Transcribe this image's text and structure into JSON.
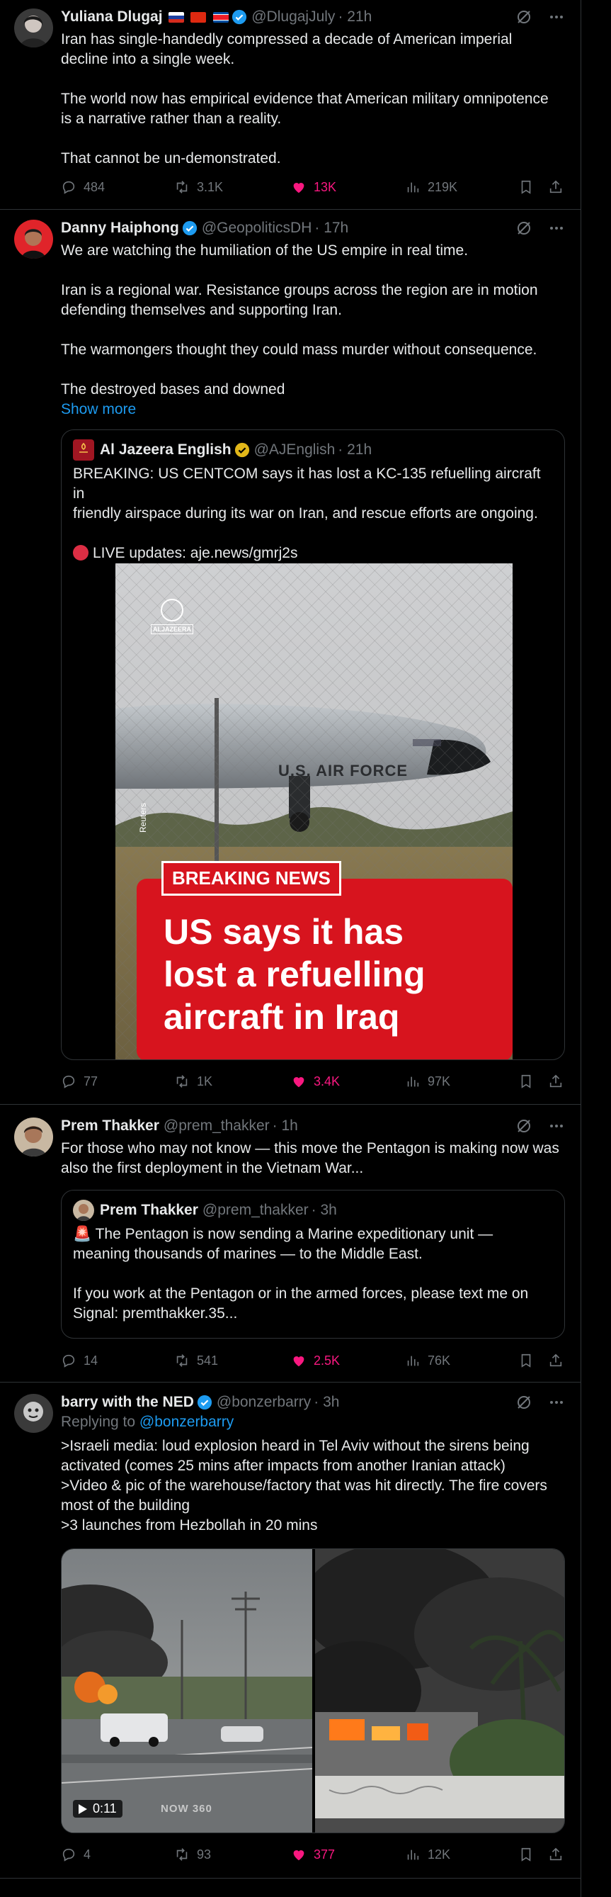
{
  "tweets": [
    {
      "name": "Yuliana Dlugaj",
      "handle": "@DlugajJuly",
      "time": "· 21h",
      "lines": [
        "Iran has single-handedly compressed a decade of American imperial",
        "decline into a single week.",
        "",
        "The world now has empirical evidence that American military omnipotence",
        "is a narrative rather than a reality.",
        "",
        "That cannot be un-demonstrated."
      ],
      "replies": "484",
      "reposts": "3.1K",
      "likes": "13K",
      "views": "219K"
    },
    {
      "name": "Danny Haiphong",
      "handle": "@GeopoliticsDH",
      "time": "· 17h",
      "lines": [
        "We are watching the humiliation of the US empire in real time.",
        "",
        "Iran is a regional war. Resistance  groups across the region are in motion",
        "defending themselves and supporting Iran.",
        "",
        "The warmongers thought they could mass murder without consequence.",
        "",
        "The destroyed bases and downed"
      ],
      "show_more": "Show more",
      "quote": {
        "name": "Al Jazeera English",
        "handle": "@AJEnglish",
        "time": "· 21h",
        "lines": [
          "BREAKING: US CENTCOM says it has lost a KC-135 refuelling aircraft in",
          "friendly airspace during its war on Iran, and rescue efforts are ongoing."
        ],
        "live_line": "LIVE updates: aje.news/gmrj2s",
        "media": {
          "logo_text": "ALJAZEERA",
          "plane_text": "U.S. AIR FORCE",
          "credit": "Reuters",
          "badge": "BREAKING NEWS",
          "headline": [
            "US says it has",
            "lost a refuelling",
            "aircraft in Iraq"
          ]
        }
      },
      "replies": "77",
      "reposts": "1K",
      "likes": "3.4K",
      "views": "97K"
    },
    {
      "name": "Prem Thakker",
      "handle": "@prem_thakker",
      "time": "· 1h",
      "lines": [
        "For those who may not know — this move the Pentagon is making now was",
        "also the first deployment in the Vietnam War..."
      ],
      "quote": {
        "name": "Prem Thakker",
        "handle": "@prem_thakker",
        "time": "· 3h",
        "lines": [
          "🚨 The Pentagon is now sending a Marine expeditionary unit —",
          "meaning thousands of marines — to the Middle East.",
          "",
          "If you work at the Pentagon or in the armed forces, please text me on",
          "Signal: premthakker.35..."
        ]
      },
      "replies": "14",
      "reposts": "541",
      "likes": "2.5K",
      "views": "76K"
    },
    {
      "name": "barry with the NED",
      "handle": "@bonzerbarry",
      "time": "· 3h",
      "replying_prefix": "Replying to",
      "replying_handle": "@bonzerbarry",
      "lines": [
        ">Israeli media: loud explosion heard in Tel Aviv without the sirens being",
        "activated (comes 25 mins after impacts from another Iranian attack)",
        ">Video & pic of the warehouse/factory that was hit directly. The fire covers",
        "most of the building",
        ">3 launches from Hezbollah in 20 mins"
      ],
      "video_duration": "0:11",
      "video_watermark": "NOW 360",
      "replies": "4",
      "reposts": "93",
      "likes": "377",
      "views": "12K"
    }
  ],
  "colors": {
    "background": "#000000",
    "text": "#e7e9ea",
    "muted": "#71767b",
    "accent": "#1d9bf0",
    "like": "#f91880",
    "border": "#2f3336",
    "breaking_red": "#d7141e"
  },
  "icons": [
    "grok-icon",
    "more-icon",
    "reply-icon",
    "repost-icon",
    "like-icon",
    "views-icon",
    "bookmark-icon",
    "share-icon",
    "verified-icon",
    "play-icon"
  ]
}
